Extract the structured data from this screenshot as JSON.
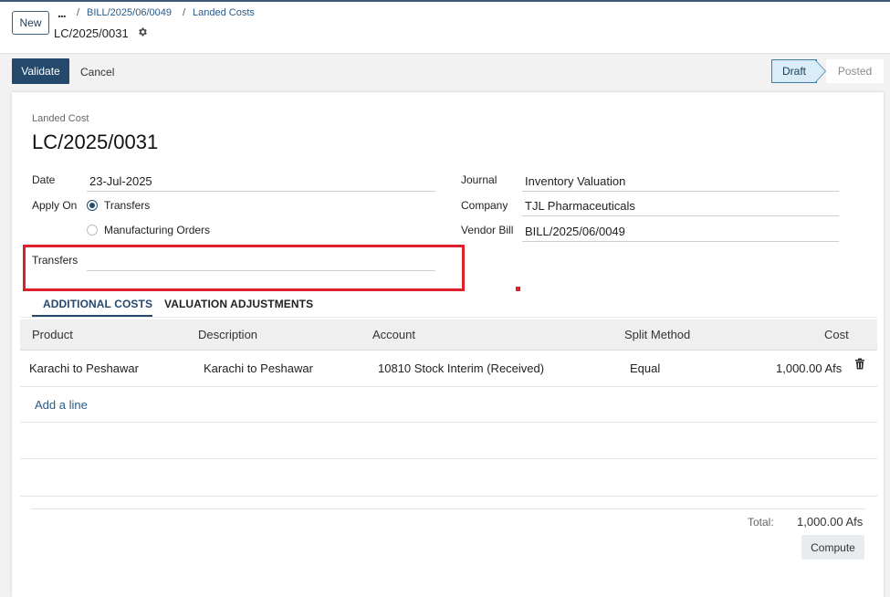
{
  "header": {
    "new_label": "New",
    "more_label": "...",
    "breadcrumbs": [
      {
        "label": "BILL/2025/06/0049"
      },
      {
        "label": "Landed Costs"
      }
    ],
    "record_name": "LC/2025/0031"
  },
  "actions": {
    "validate_label": "Validate",
    "cancel_label": "Cancel"
  },
  "status": {
    "steps": [
      "Draft",
      "Posted"
    ],
    "current": "Draft"
  },
  "form": {
    "record_type": "Landed Cost",
    "title": "LC/2025/0031",
    "date": {
      "label": "Date",
      "value": "23-Jul-2025"
    },
    "apply_on": {
      "label": "Apply On",
      "options": [
        "Transfers",
        "Manufacturing Orders"
      ],
      "selected": "Transfers"
    },
    "transfers": {
      "label": "Transfers",
      "value": ""
    },
    "journal": {
      "label": "Journal",
      "value": "Inventory Valuation"
    },
    "company": {
      "label": "Company",
      "value": "TJL Pharmaceuticals"
    },
    "vendor_bill": {
      "label": "Vendor Bill",
      "value": "BILL/2025/06/0049"
    }
  },
  "tabs": [
    {
      "label": "ADDITIONAL COSTS",
      "active": true
    },
    {
      "label": "VALUATION ADJUSTMENTS",
      "active": false
    }
  ],
  "table": {
    "columns": [
      "Product",
      "Description",
      "Account",
      "Split Method",
      "Cost"
    ],
    "rows": [
      {
        "product": "Karachi to Peshawar",
        "description": "Karachi to Peshawar",
        "account": "10810 Stock Interim (Received)",
        "split_method": "Equal",
        "cost": "1,000.00 Afs"
      }
    ],
    "add_line_label": "Add a line"
  },
  "totals": {
    "label": "Total:",
    "value": "1,000.00 Afs",
    "compute_label": "Compute"
  },
  "colors": {
    "primary": "#25496d",
    "highlight": "#e0202a",
    "status_active_bg": "#d9ecf7"
  },
  "icons": {
    "settings": "gear-icon",
    "delete_row": "trash-icon"
  }
}
